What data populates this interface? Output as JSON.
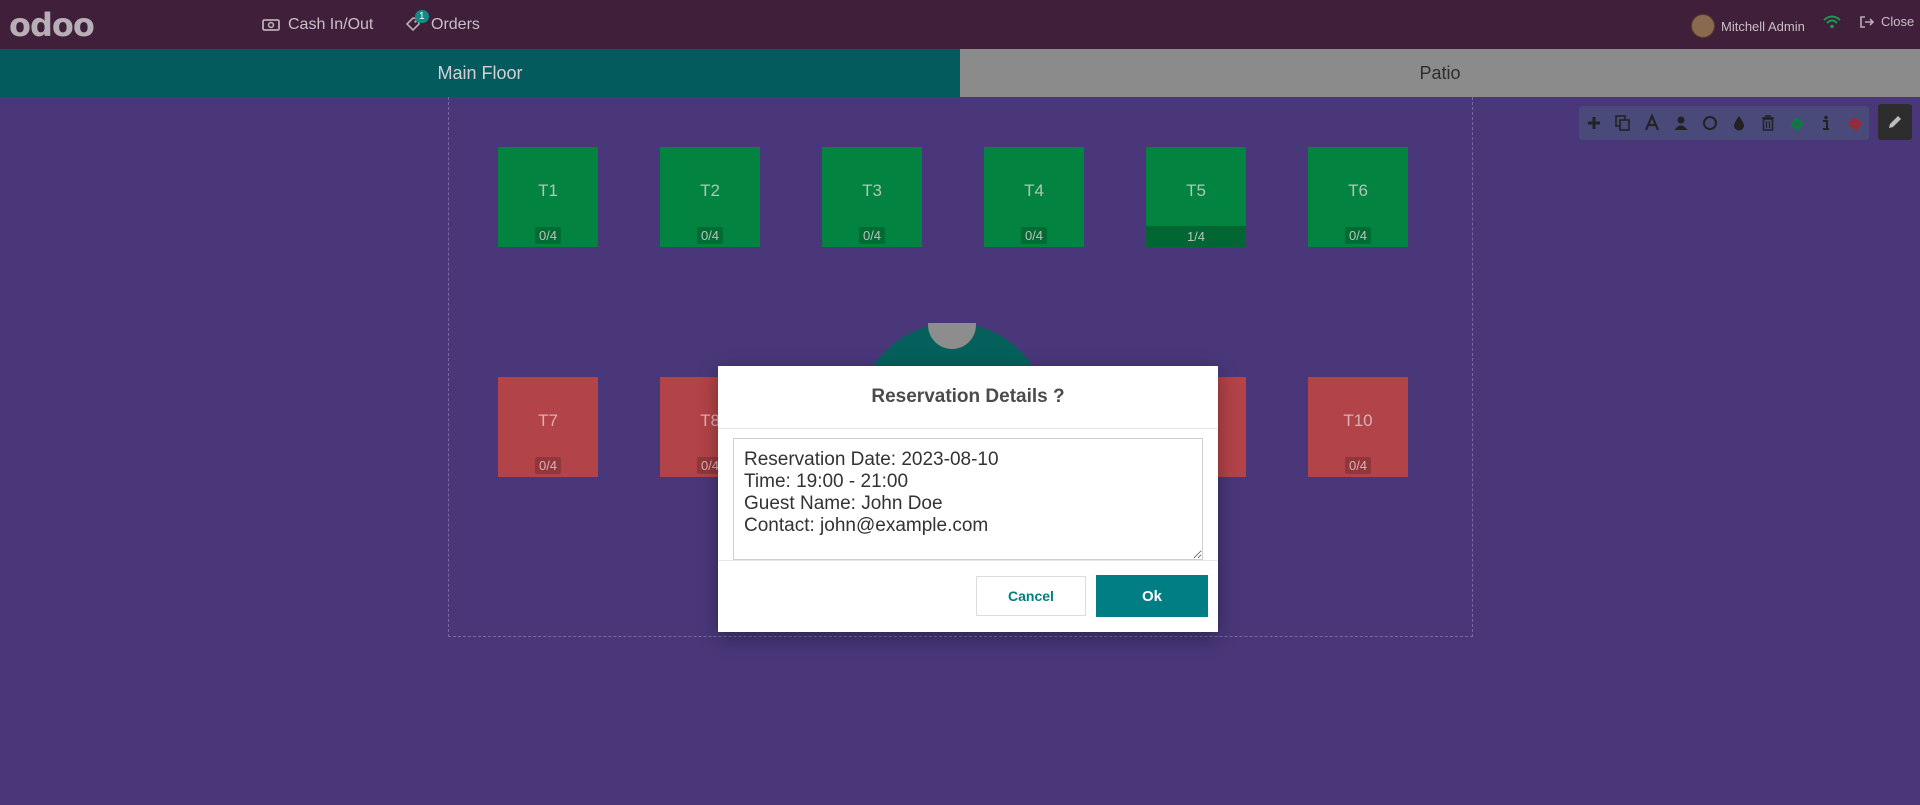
{
  "navbar": {
    "logo": "odoo",
    "cash_label": "Cash In/Out",
    "orders_label": "Orders",
    "orders_badge": "1",
    "user_name": "Mitchell Admin",
    "close_label": "Close"
  },
  "floors": [
    {
      "label": "Main Floor",
      "active": true
    },
    {
      "label": "Patio",
      "active": false
    }
  ],
  "tables": [
    {
      "name": "T1",
      "seats": "0/4",
      "status": "green"
    },
    {
      "name": "T2",
      "seats": "0/4",
      "status": "green"
    },
    {
      "name": "T3",
      "seats": "0/4",
      "status": "green"
    },
    {
      "name": "T4",
      "seats": "0/4",
      "status": "green"
    },
    {
      "name": "T5",
      "seats": "1/4",
      "status": "green"
    },
    {
      "name": "T6",
      "seats": "0/4",
      "status": "green"
    },
    {
      "name": "T7",
      "seats": "0/4",
      "status": "red"
    },
    {
      "name": "T8",
      "seats": "0/4",
      "status": "red"
    },
    {
      "name": "T10",
      "seats": "0/4",
      "status": "red"
    }
  ],
  "toolbar": {
    "icons": [
      "plus-icon",
      "copy-icon",
      "font-icon",
      "user-icon",
      "circle-icon",
      "tint-icon",
      "trash-icon",
      "ticket-green-icon",
      "info-icon",
      "ticket-red-icon"
    ],
    "edit_icon": "pencil-icon"
  },
  "modal": {
    "title": "Reservation Details ?",
    "text": "Reservation Date: 2023-08-10\nTime: 19:00 - 21:00\nGuest Name: John Doe\nContact: john@example.com",
    "cancel_label": "Cancel",
    "ok_label": "Ok"
  },
  "colors": {
    "navbar": "#3f1f3a",
    "floor_bg": "#49377a",
    "tab_active": "#045b5e",
    "tab_inactive": "#8b8b8b",
    "table_green": "#02833f",
    "table_red": "#b24348",
    "primary": "#017e84"
  }
}
